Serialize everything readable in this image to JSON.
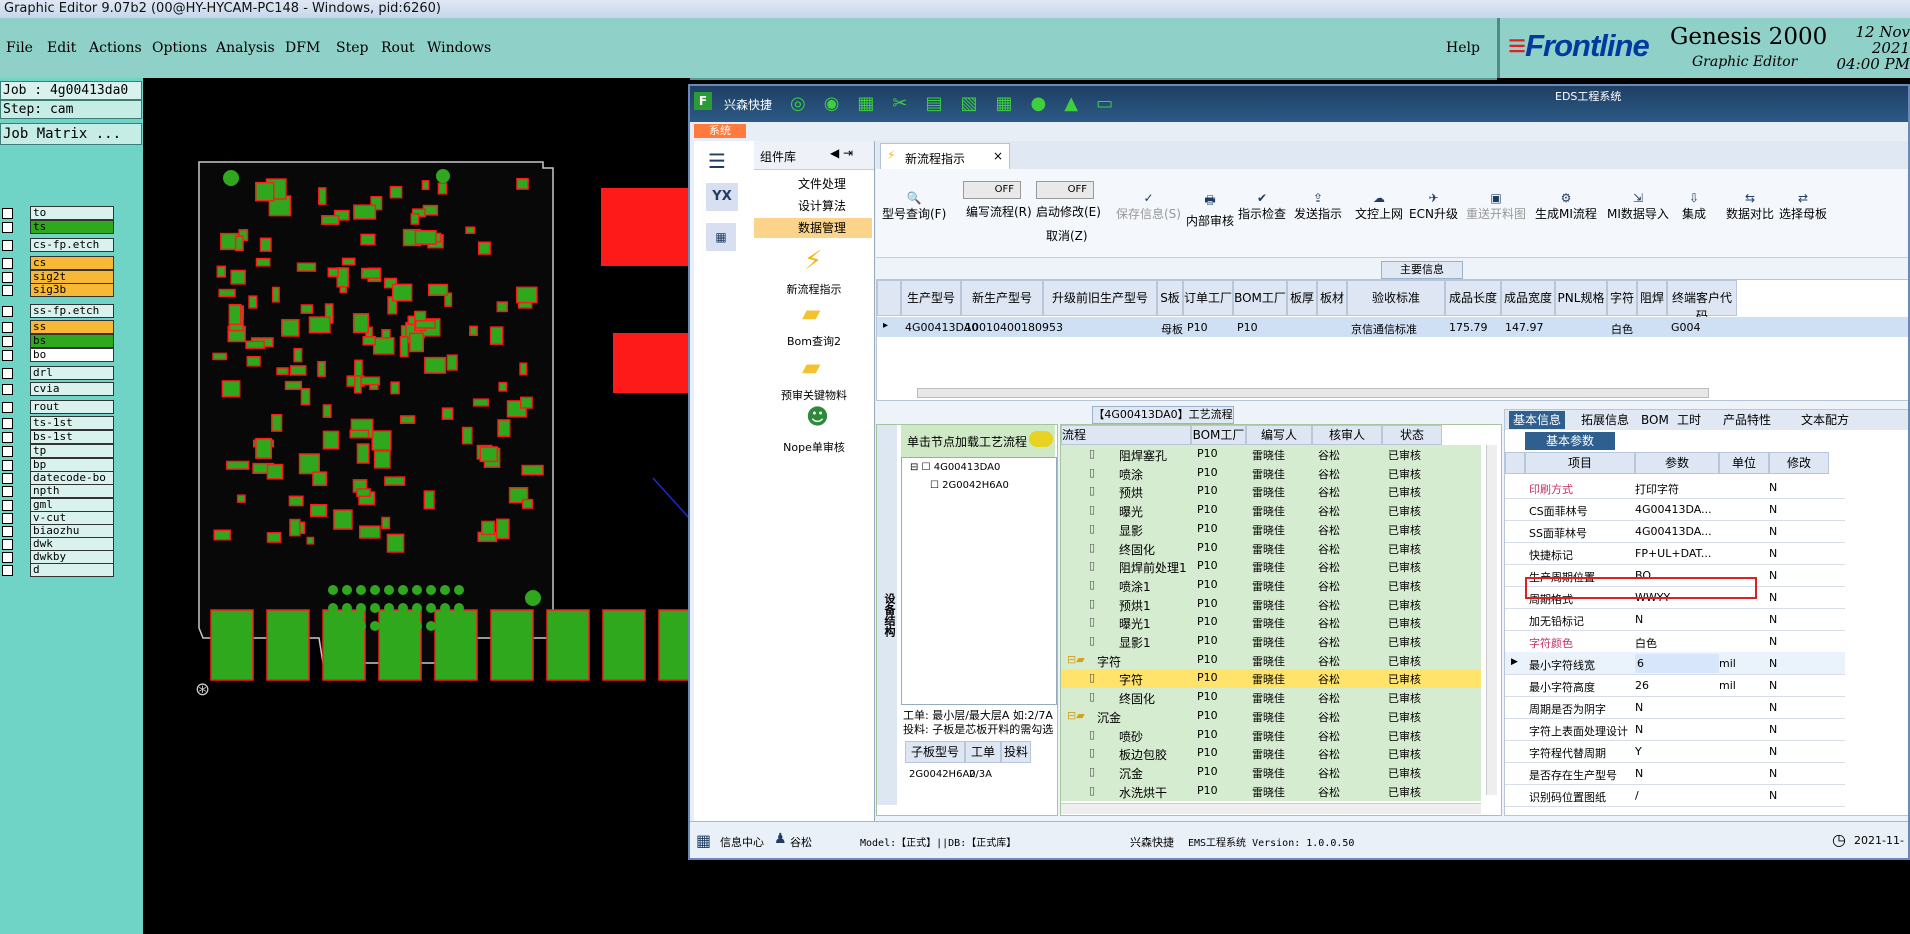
{
  "title_bar": {
    "text": "Graphic Editor 9.07b2 (00@HY-HYCAM-PC148 - Windows, pid:6260)"
  },
  "menu": {
    "items": [
      "File",
      "Edit",
      "Actions",
      "Options",
      "Analysis",
      "DFM",
      "Step",
      "Rout",
      "Windows"
    ],
    "help": "Help"
  },
  "brand": {
    "logo": "Frontline",
    "product": "Genesis 2000",
    "subtitle": "Graphic Editor",
    "date_line1": "12 Nov 2021",
    "date_line2": "04:00 PM"
  },
  "job_panel": {
    "job": "Job : 4g00413da0",
    "step": "Step: cam",
    "matrix": "Job Matrix ...",
    "layers": [
      "to",
      "ts",
      "cs-fp.etch",
      "cs",
      "sig2t",
      "sig3b",
      "ss-fp.etch",
      "ss",
      "bs",
      "bo",
      "drl",
      "cvia",
      "rout",
      "ts-1st",
      "bs-1st",
      "tp",
      "bp",
      "datecode-bo",
      "npth",
      "gml",
      "v-cut",
      "biaozhu",
      "dwk",
      "dwkby",
      "d"
    ]
  },
  "erp": {
    "app_name": "兴森快捷",
    "system_label": "EDS工程系统",
    "sys_tab": "系统",
    "component_lib": "组件库",
    "groups": [
      "文件处理",
      "设计算法",
      "数据管理"
    ],
    "nav_items": [
      "新流程指示",
      "Bom查询2",
      "预审关键物料",
      "Nope单审核"
    ],
    "active_tab": "新流程指示",
    "toolbar": [
      "型号查询(F)",
      "编写流程(R)",
      "启动修改(E)",
      "保存信息(S)",
      "内部审核",
      "指示检查",
      "发送指示",
      "文控上网",
      "ECN升级",
      "重送开料图",
      "生成MI流程",
      "MI数据导入",
      "集成",
      "数据对比",
      "选择母板"
    ],
    "toggle_off": "OFF",
    "cancel": "取消(Z)",
    "main_info_title": "主要信息",
    "main_columns": [
      "生产型号",
      "新生产型号",
      "升级前旧生产型号",
      "S板",
      "订单工厂",
      "BOM工厂",
      "板厚",
      "板材",
      "验收标准",
      "成品长度",
      "成品宽度",
      "PNL规格",
      "字符",
      "阻焊",
      "终端客户代码"
    ],
    "main_row": [
      "4G00413DA0",
      "10010400180953",
      "",
      "母板",
      "P10",
      "P10",
      "",
      "",
      "京信通信标准",
      "175.79",
      "147.97",
      "",
      "白色",
      "",
      "G004"
    ],
    "process_title": "【4G00413DA0】工艺流程",
    "tree_hint": "单击节点加载工艺流程",
    "tree_side_label": "设备结构",
    "tree_nodes": [
      "4G00413DA0",
      "2G0042H6A0"
    ],
    "work_note_1": "工单: 最小层/最大层A 如:2/7A",
    "work_note_2": "投料: 子板是芯板开料的需勾选",
    "sub_columns": [
      "子板型号",
      "工单",
      "投料"
    ],
    "sub_row": [
      "2G0042H6A0",
      "2/3A",
      ""
    ],
    "flow_columns": [
      "流程",
      "BOM工厂",
      "编写人",
      "核审人",
      "状态"
    ],
    "flow_rows": [
      [
        "阻焊塞孔",
        "P10",
        "雷晓佳",
        "谷松",
        "已审核"
      ],
      [
        "喷涂",
        "P10",
        "雷晓佳",
        "谷松",
        "已审核"
      ],
      [
        "预烘",
        "P10",
        "雷晓佳",
        "谷松",
        "已审核"
      ],
      [
        "曝光",
        "P10",
        "雷晓佳",
        "谷松",
        "已审核"
      ],
      [
        "显影",
        "P10",
        "雷晓佳",
        "谷松",
        "已审核"
      ],
      [
        "终固化",
        "P10",
        "雷晓佳",
        "谷松",
        "已审核"
      ],
      [
        "阻焊前处理1",
        "P10",
        "雷晓佳",
        "谷松",
        "已审核"
      ],
      [
        "喷涂1",
        "P10",
        "雷晓佳",
        "谷松",
        "已审核"
      ],
      [
        "预烘1",
        "P10",
        "雷晓佳",
        "谷松",
        "已审核"
      ],
      [
        "曝光1",
        "P10",
        "雷晓佳",
        "谷松",
        "已审核"
      ],
      [
        "显影1",
        "P10",
        "雷晓佳",
        "谷松",
        "已审核"
      ],
      [
        "字符",
        "P10",
        "雷晓佳",
        "谷松",
        "已审核"
      ],
      [
        "字符",
        "P10",
        "雷晓佳",
        "谷松",
        "已审核"
      ],
      [
        "终固化",
        "P10",
        "雷晓佳",
        "谷松",
        "已审核"
      ],
      [
        "沉金",
        "P10",
        "雷晓佳",
        "谷松",
        "已审核"
      ],
      [
        "喷砂",
        "P10",
        "雷晓佳",
        "谷松",
        "已审核"
      ],
      [
        "板边包胶",
        "P10",
        "雷晓佳",
        "谷松",
        "已审核"
      ],
      [
        "沉金",
        "P10",
        "雷晓佳",
        "谷松",
        "已审核"
      ],
      [
        "水洗烘干",
        "P10",
        "雷晓佳",
        "谷松",
        "已审核"
      ]
    ],
    "prop_tabs": [
      "基本信息",
      "拓展信息",
      "BOM",
      "工时",
      "产品特性",
      "文本配方"
    ],
    "prop_subtitle": "基本参数",
    "prop_columns": [
      "项目",
      "参数",
      "单位",
      "修改"
    ],
    "prop_rows": [
      [
        "印刷方式",
        "打印字符",
        "",
        "N"
      ],
      [
        "CS面菲林号",
        "4G00413DA...",
        "",
        "N"
      ],
      [
        "SS面菲林号",
        "4G00413DA...",
        "",
        "N"
      ],
      [
        "快捷标记",
        "FP+UL+DAT...",
        "",
        "N"
      ],
      [
        "生产周期位置",
        "BO",
        "",
        "N"
      ],
      [
        "周期格式",
        "WWYY",
        "",
        "N"
      ],
      [
        "加无铅标记",
        "N",
        "",
        "N"
      ],
      [
        "字符颜色",
        "白色",
        "",
        "N"
      ],
      [
        "最小字符线宽",
        "6",
        "mil",
        "N"
      ],
      [
        "最小字符高度",
        "26",
        "mil",
        "N"
      ],
      [
        "周期是否为阴字",
        "N",
        "",
        "N"
      ],
      [
        "字符上表面处理设计",
        "N",
        "",
        "N"
      ],
      [
        "字符程代替周期",
        "Y",
        "",
        "N"
      ],
      [
        "是否存在生产型号",
        "N",
        "",
        "N"
      ],
      [
        "识别码位置图纸",
        "/",
        "",
        "N"
      ]
    ],
    "status": {
      "info_center": "信息中心",
      "user": "谷松",
      "model": "Model:【正式】||DB:【正式库】",
      "brand": "兴森快捷",
      "version": "EMS工程系统 Version: 1.0.0.50",
      "date": "2021-11-"
    }
  },
  "colors": {
    "pcb_red": "#ff1a1a",
    "pcb_green": "#2fa81e",
    "genesis_teal": "#8fd0c8",
    "erp_highlight": "#ffe36b",
    "red_box": "#e02020"
  }
}
